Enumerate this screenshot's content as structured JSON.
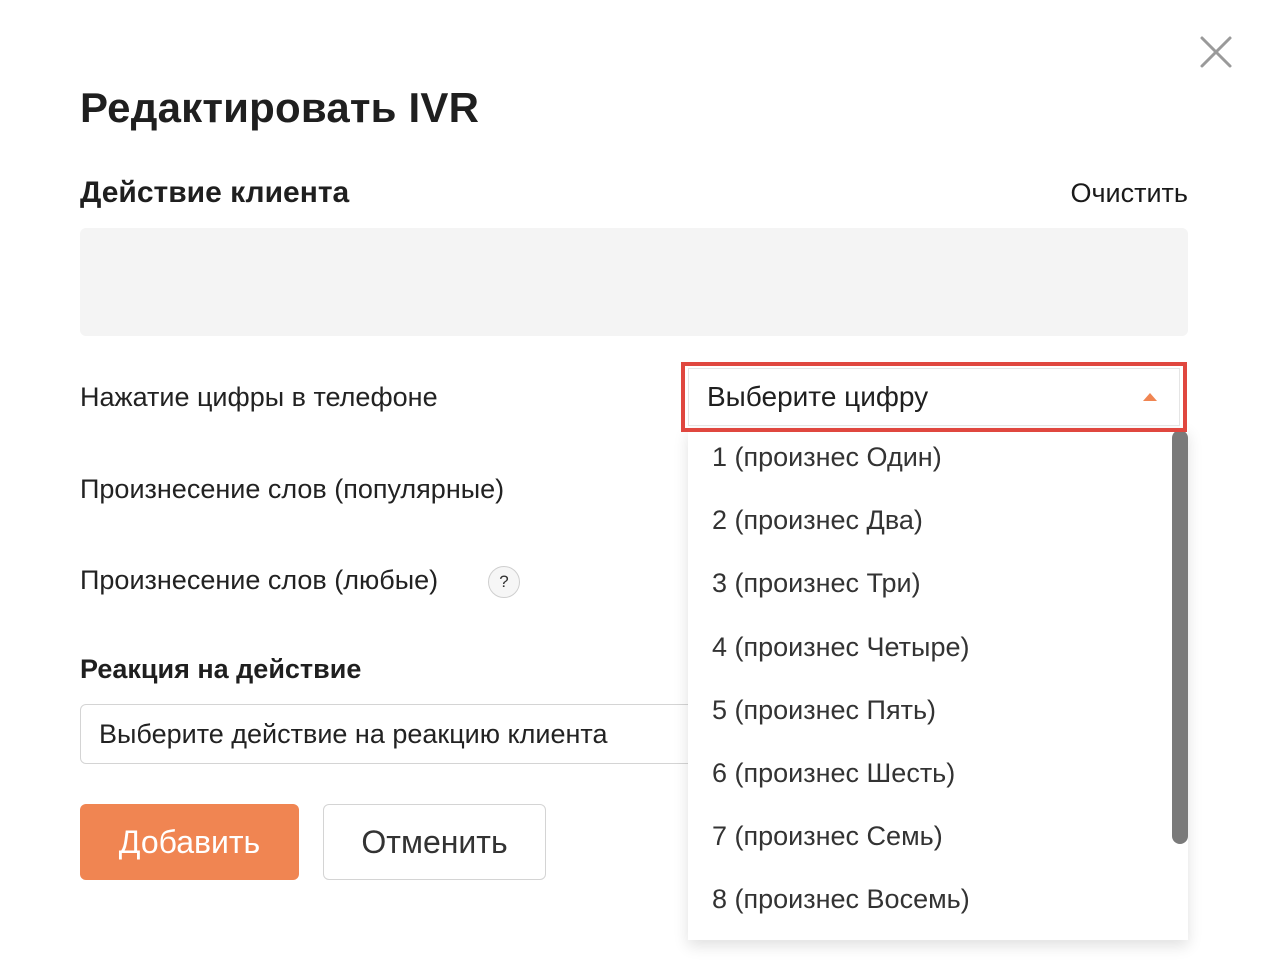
{
  "modal": {
    "title": "Редактировать IVR",
    "client_action": {
      "heading": "Действие клиента",
      "clear_label": "Очистить"
    },
    "options": [
      {
        "label": "Нажатие цифры в телефоне"
      },
      {
        "label": "Произнесение слов (популярные)"
      },
      {
        "label": "Произнесение слов (любые)"
      }
    ],
    "help_icon_glyph": "?",
    "reaction": {
      "heading": "Реакция на действие",
      "select_placeholder": "Выберите действие на реакцию клиента"
    },
    "buttons": {
      "add_label": "Добавить",
      "cancel_label": "Отменить"
    },
    "digit_select": {
      "placeholder": "Выберите цифру",
      "options": [
        "1 (произнес Один)",
        "2 (произнес Два)",
        "3 (произнес Три)",
        "4 (произнес Четыре)",
        "5 (произнес Пять)",
        "6 (произнес Шесть)",
        "7 (произнес Семь)",
        "8 (произнес Восемь)"
      ]
    },
    "colors": {
      "accent": "#f08552",
      "highlight": "#e0473f"
    },
    "icons": {
      "close": "close-icon",
      "caret": "caret-up-icon",
      "help": "question-icon"
    }
  }
}
